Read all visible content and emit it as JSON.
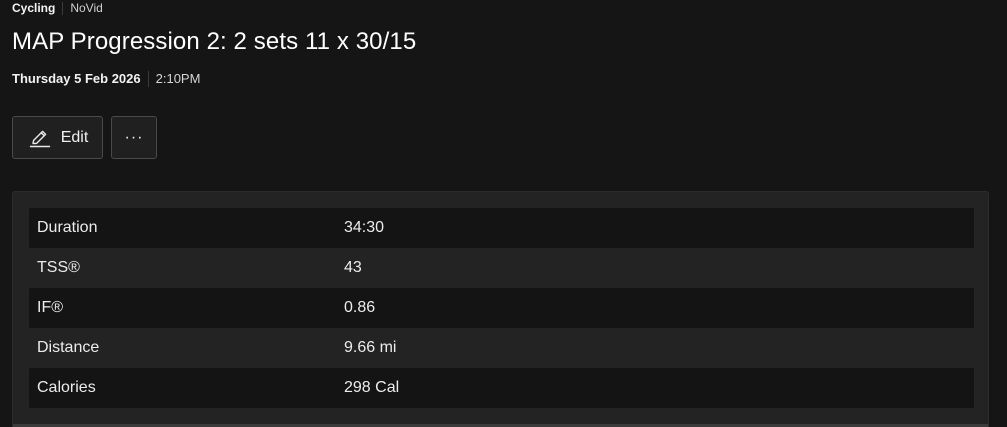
{
  "header": {
    "sport": "Cycling",
    "tag": "NoVid"
  },
  "workout": {
    "title": "MAP Progression 2: 2 sets 11 x 30/15",
    "date": "Thursday 5 Feb 2026",
    "time": "2:10PM"
  },
  "actions": {
    "edit_label": "Edit",
    "edit_icon": "pencil-icon",
    "more_label": "···",
    "more_icon": "more-horizontal-icon"
  },
  "stats": [
    {
      "label": "Duration",
      "value": "34:30"
    },
    {
      "label": "TSS®",
      "value": "43"
    },
    {
      "label": "IF®",
      "value": "0.86"
    },
    {
      "label": "Distance",
      "value": "9.66 mi"
    },
    {
      "label": "Calories",
      "value": "298 Cal"
    }
  ],
  "colors": {
    "background": "#151515",
    "panel": "#232323",
    "row_dark": "#141414",
    "text": "#f2f2f2",
    "button_border": "#4a4a4a"
  }
}
